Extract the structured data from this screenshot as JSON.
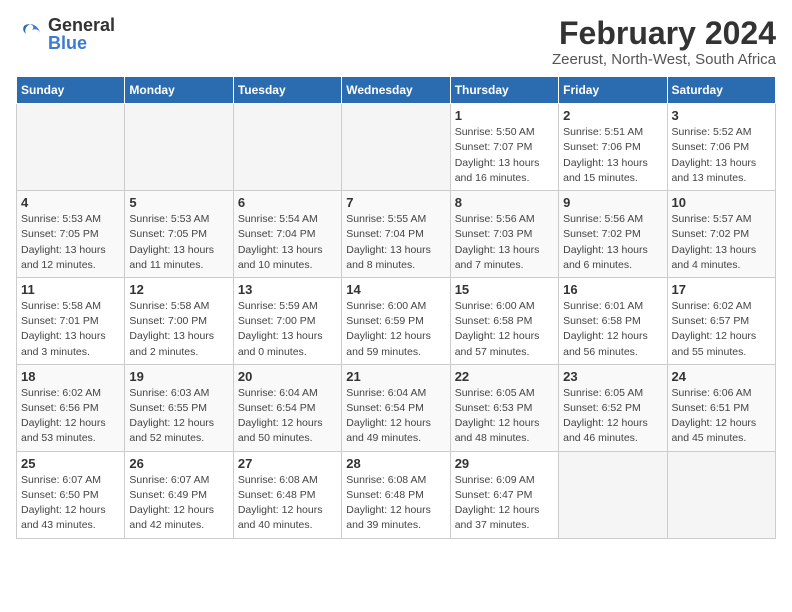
{
  "logo": {
    "text_general": "General",
    "text_blue": "Blue"
  },
  "title": "February 2024",
  "subtitle": "Zeerust, North-West, South Africa",
  "weekdays": [
    "Sunday",
    "Monday",
    "Tuesday",
    "Wednesday",
    "Thursday",
    "Friday",
    "Saturday"
  ],
  "weeks": [
    [
      {
        "day": "",
        "info": ""
      },
      {
        "day": "",
        "info": ""
      },
      {
        "day": "",
        "info": ""
      },
      {
        "day": "",
        "info": ""
      },
      {
        "day": "1",
        "info": "Sunrise: 5:50 AM\nSunset: 7:07 PM\nDaylight: 13 hours\nand 16 minutes."
      },
      {
        "day": "2",
        "info": "Sunrise: 5:51 AM\nSunset: 7:06 PM\nDaylight: 13 hours\nand 15 minutes."
      },
      {
        "day": "3",
        "info": "Sunrise: 5:52 AM\nSunset: 7:06 PM\nDaylight: 13 hours\nand 13 minutes."
      }
    ],
    [
      {
        "day": "4",
        "info": "Sunrise: 5:53 AM\nSunset: 7:05 PM\nDaylight: 13 hours\nand 12 minutes."
      },
      {
        "day": "5",
        "info": "Sunrise: 5:53 AM\nSunset: 7:05 PM\nDaylight: 13 hours\nand 11 minutes."
      },
      {
        "day": "6",
        "info": "Sunrise: 5:54 AM\nSunset: 7:04 PM\nDaylight: 13 hours\nand 10 minutes."
      },
      {
        "day": "7",
        "info": "Sunrise: 5:55 AM\nSunset: 7:04 PM\nDaylight: 13 hours\nand 8 minutes."
      },
      {
        "day": "8",
        "info": "Sunrise: 5:56 AM\nSunset: 7:03 PM\nDaylight: 13 hours\nand 7 minutes."
      },
      {
        "day": "9",
        "info": "Sunrise: 5:56 AM\nSunset: 7:02 PM\nDaylight: 13 hours\nand 6 minutes."
      },
      {
        "day": "10",
        "info": "Sunrise: 5:57 AM\nSunset: 7:02 PM\nDaylight: 13 hours\nand 4 minutes."
      }
    ],
    [
      {
        "day": "11",
        "info": "Sunrise: 5:58 AM\nSunset: 7:01 PM\nDaylight: 13 hours\nand 3 minutes."
      },
      {
        "day": "12",
        "info": "Sunrise: 5:58 AM\nSunset: 7:00 PM\nDaylight: 13 hours\nand 2 minutes."
      },
      {
        "day": "13",
        "info": "Sunrise: 5:59 AM\nSunset: 7:00 PM\nDaylight: 13 hours\nand 0 minutes."
      },
      {
        "day": "14",
        "info": "Sunrise: 6:00 AM\nSunset: 6:59 PM\nDaylight: 12 hours\nand 59 minutes."
      },
      {
        "day": "15",
        "info": "Sunrise: 6:00 AM\nSunset: 6:58 PM\nDaylight: 12 hours\nand 57 minutes."
      },
      {
        "day": "16",
        "info": "Sunrise: 6:01 AM\nSunset: 6:58 PM\nDaylight: 12 hours\nand 56 minutes."
      },
      {
        "day": "17",
        "info": "Sunrise: 6:02 AM\nSunset: 6:57 PM\nDaylight: 12 hours\nand 55 minutes."
      }
    ],
    [
      {
        "day": "18",
        "info": "Sunrise: 6:02 AM\nSunset: 6:56 PM\nDaylight: 12 hours\nand 53 minutes."
      },
      {
        "day": "19",
        "info": "Sunrise: 6:03 AM\nSunset: 6:55 PM\nDaylight: 12 hours\nand 52 minutes."
      },
      {
        "day": "20",
        "info": "Sunrise: 6:04 AM\nSunset: 6:54 PM\nDaylight: 12 hours\nand 50 minutes."
      },
      {
        "day": "21",
        "info": "Sunrise: 6:04 AM\nSunset: 6:54 PM\nDaylight: 12 hours\nand 49 minutes."
      },
      {
        "day": "22",
        "info": "Sunrise: 6:05 AM\nSunset: 6:53 PM\nDaylight: 12 hours\nand 48 minutes."
      },
      {
        "day": "23",
        "info": "Sunrise: 6:05 AM\nSunset: 6:52 PM\nDaylight: 12 hours\nand 46 minutes."
      },
      {
        "day": "24",
        "info": "Sunrise: 6:06 AM\nSunset: 6:51 PM\nDaylight: 12 hours\nand 45 minutes."
      }
    ],
    [
      {
        "day": "25",
        "info": "Sunrise: 6:07 AM\nSunset: 6:50 PM\nDaylight: 12 hours\nand 43 minutes."
      },
      {
        "day": "26",
        "info": "Sunrise: 6:07 AM\nSunset: 6:49 PM\nDaylight: 12 hours\nand 42 minutes."
      },
      {
        "day": "27",
        "info": "Sunrise: 6:08 AM\nSunset: 6:48 PM\nDaylight: 12 hours\nand 40 minutes."
      },
      {
        "day": "28",
        "info": "Sunrise: 6:08 AM\nSunset: 6:48 PM\nDaylight: 12 hours\nand 39 minutes."
      },
      {
        "day": "29",
        "info": "Sunrise: 6:09 AM\nSunset: 6:47 PM\nDaylight: 12 hours\nand 37 minutes."
      },
      {
        "day": "",
        "info": ""
      },
      {
        "day": "",
        "info": ""
      }
    ]
  ]
}
